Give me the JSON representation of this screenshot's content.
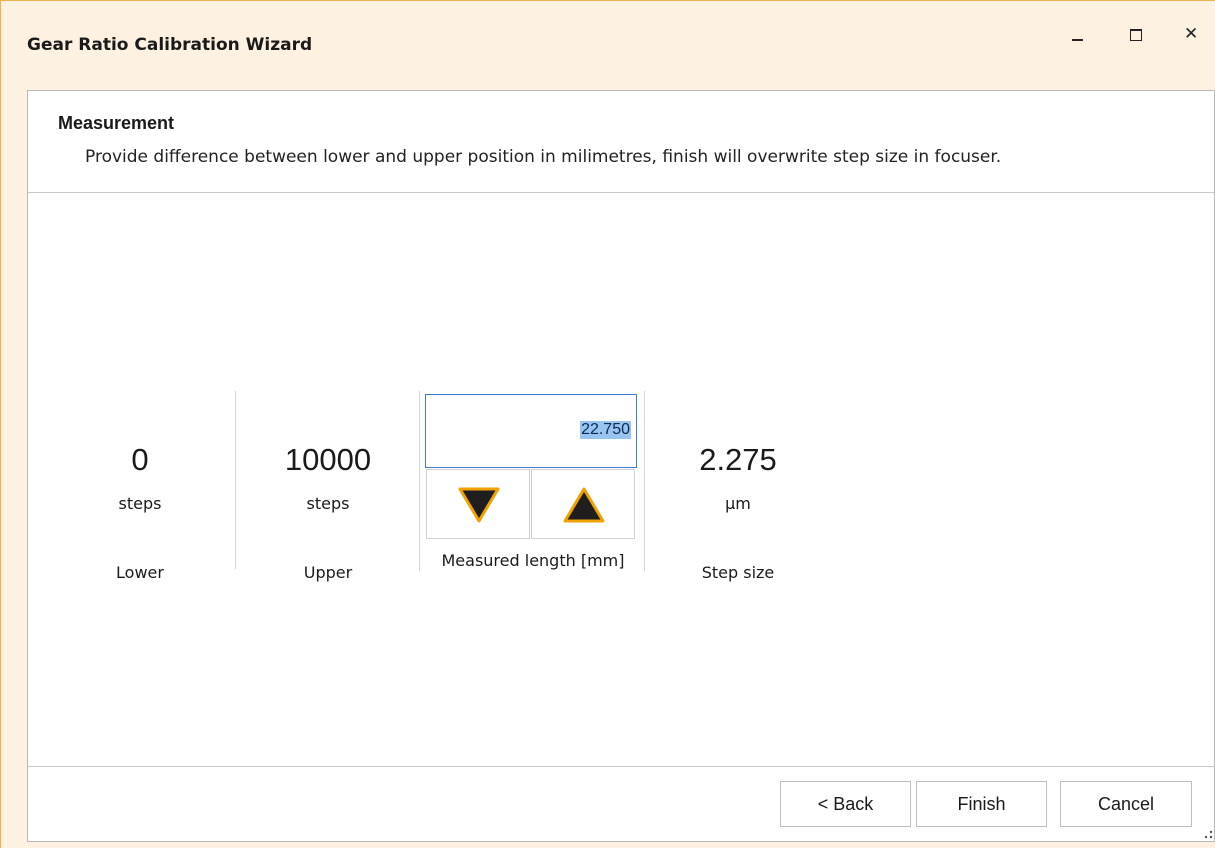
{
  "window": {
    "title": "Gear Ratio Calibration Wizard",
    "controls": [
      "minimize",
      "maximize",
      "close"
    ],
    "close_glyph": "✕"
  },
  "header": {
    "title": "Measurement",
    "description": "Provide difference between lower and upper position in milimetres, finish will overwrite step size in focuser."
  },
  "fields": {
    "lower": {
      "value": "0",
      "unit": "steps",
      "label": "Lower"
    },
    "upper": {
      "value": "10000",
      "unit": "steps",
      "label": "Upper"
    },
    "measured": {
      "value": "22.750",
      "label": "Measured length [mm]",
      "decrease_icon": "triangle-down-icon",
      "increase_icon": "triangle-up-icon"
    },
    "step_size": {
      "value": "2.275",
      "unit": "µm",
      "label": "Step size"
    }
  },
  "buttons": {
    "back": "< Back",
    "finish": "Finish",
    "cancel": "Cancel"
  },
  "colors": {
    "window_accent": "#f0b24a",
    "titlebar_bg": "#fdf2e1",
    "input_border": "#3f7ad8",
    "selection": "#99c3f0",
    "arrow_fill": "#1e1e1e",
    "arrow_outline": "#f2a200"
  }
}
